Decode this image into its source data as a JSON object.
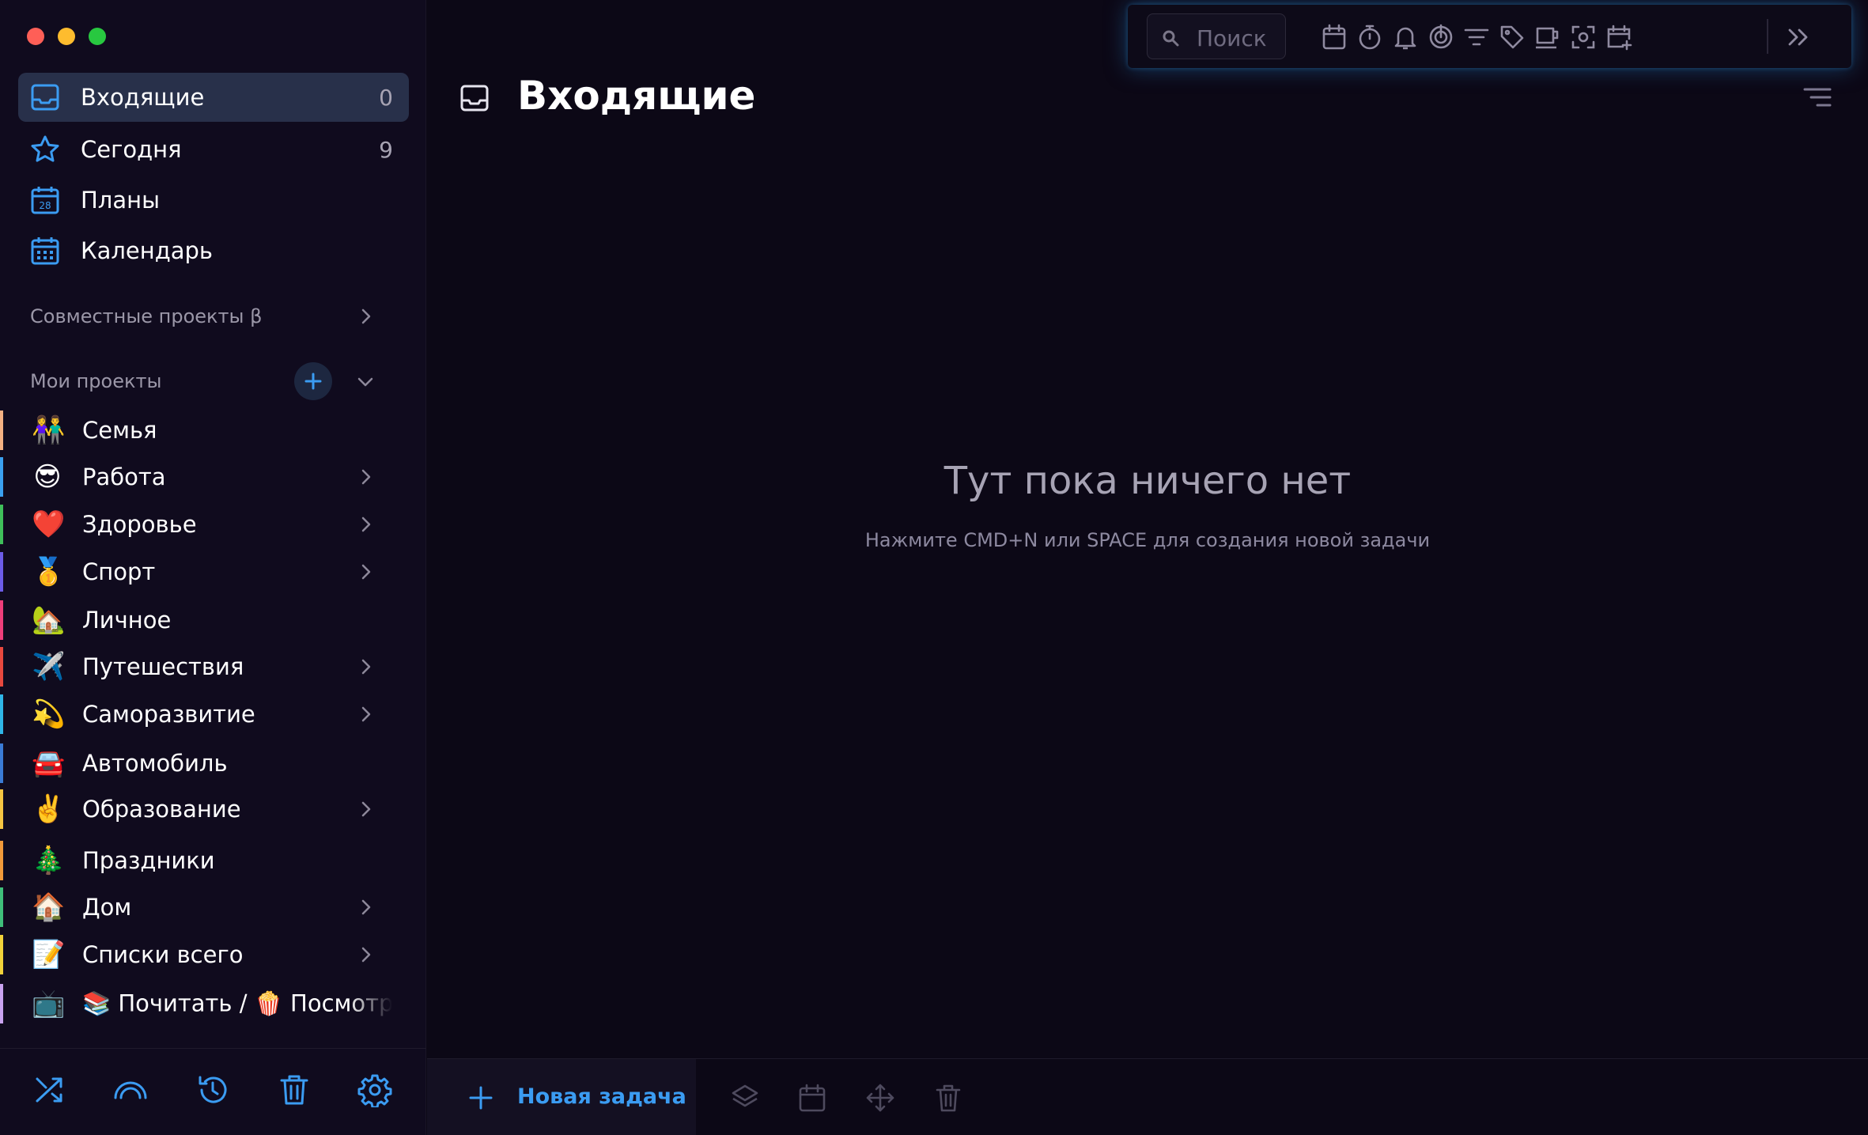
{
  "window": {
    "controls": [
      "close",
      "minimize",
      "zoom"
    ],
    "colors": {
      "close": "#fe5f57",
      "minimize": "#febc2e",
      "zoom": "#28c840"
    }
  },
  "sidebar": {
    "nav": [
      {
        "label": "Входящие",
        "count": "0",
        "icon": "inbox-icon",
        "active": true
      },
      {
        "label": "Сегодня",
        "count": "9",
        "icon": "star-icon",
        "active": false
      },
      {
        "label": "Планы",
        "count": "",
        "icon": "calendar-28-icon",
        "active": false
      },
      {
        "label": "Календарь",
        "count": "",
        "icon": "calendar-grid-icon",
        "active": false
      }
    ],
    "shared_projects_label": "Совместные проекты β",
    "my_projects_label": "Мои проекты",
    "projects": [
      {
        "label": "Семья",
        "emoji": "👫",
        "color": "#f4b183",
        "expandable": false
      },
      {
        "label": "Работа",
        "emoji": "😎",
        "color": "#3aa0f0",
        "expandable": true
      },
      {
        "label": "Здоровье",
        "emoji": "❤️",
        "color": "#3fbf5a",
        "expandable": true
      },
      {
        "label": "Спорт",
        "emoji": "🥇",
        "color": "#6c5ce7",
        "expandable": true
      },
      {
        "label": "Личное",
        "emoji": "🏡",
        "color": "#ef3e7a",
        "expandable": false
      },
      {
        "label": "Путешествия",
        "emoji": "✈️",
        "color": "#e8483e",
        "expandable": true
      },
      {
        "label": "Саморазвитие",
        "emoji": "💫",
        "color": "#2fb6e8",
        "expandable": true
      },
      {
        "label": "Автомобиль",
        "emoji": "🚘",
        "color": "#3a7bd5",
        "expandable": false
      },
      {
        "label": "Образование",
        "emoji": "✌️",
        "color": "#f5c542",
        "expandable": true
      },
      {
        "label": "Праздники",
        "emoji": "🎄",
        "color": "#f29a3a",
        "expandable": false
      },
      {
        "label": "Дом",
        "emoji": "🏠",
        "color": "#3fbf7a",
        "expandable": true
      },
      {
        "label": "Списки всего",
        "emoji": "📝",
        "color": "#f2d23a",
        "expandable": true
      },
      {
        "label": "📚 Почитать / 🍿 Посмотреть",
        "emoji": "📺",
        "color": "#c9a3f0",
        "expandable": false
      }
    ],
    "footer_icons": [
      "shuffle-icon",
      "rainbow-icon",
      "history-icon",
      "trash-icon",
      "settings-icon"
    ]
  },
  "main": {
    "title": "Входящие",
    "search_placeholder": "Поиск",
    "toolbar_icons": [
      "calendar-icon",
      "timer-icon",
      "bell-icon",
      "pomodoro-icon",
      "filter-icon",
      "tag-icon",
      "coffee-icon",
      "focus-icon",
      "add-calendar-icon",
      "expand-icon"
    ],
    "empty_title": "Тут пока ничего нет",
    "empty_subtitle": "Нажмите CMD+N или SPACE для создания новой задачи",
    "new_task_label": "Новая задача",
    "bottom_icons": [
      "layers-icon",
      "calendar-icon",
      "move-icon",
      "trash-icon"
    ],
    "accent": "#3b9cf2"
  }
}
